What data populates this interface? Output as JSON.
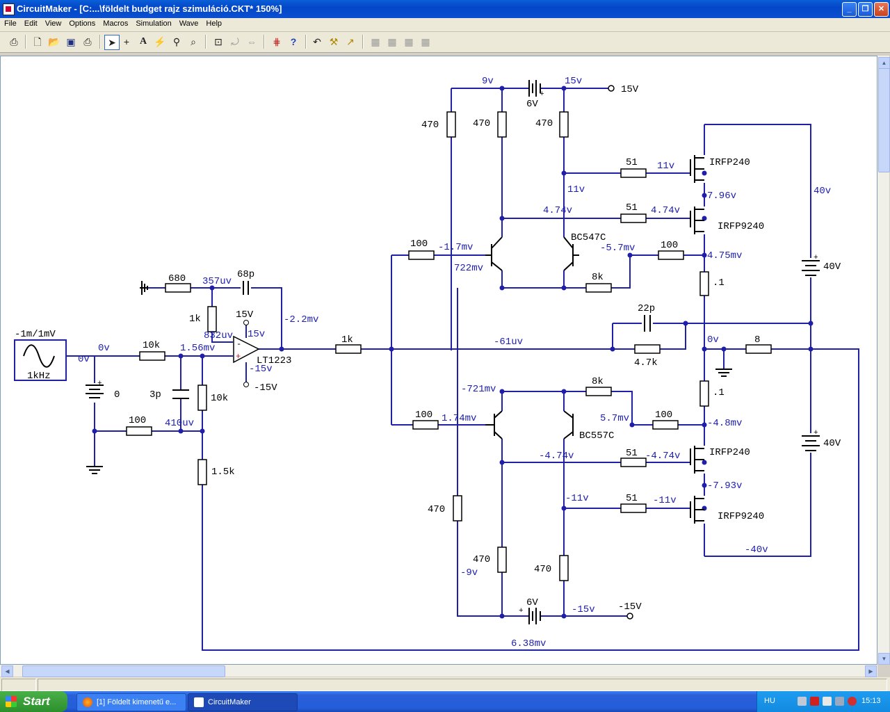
{
  "window": {
    "title": "CircuitMaker - [C:...\\földelt budget rajz szimuláció.CKT* 150%]",
    "minimize_icon": "minimize-icon",
    "maximize_icon": "restore-icon",
    "close_icon": "close-icon"
  },
  "menu": [
    "File",
    "Edit",
    "View",
    "Options",
    "Macros",
    "Simulation",
    "Wave",
    "Help"
  ],
  "toolbar": {
    "icons": [
      "print-setup-icon",
      "new-icon",
      "open-icon",
      "save-icon",
      "print-icon",
      "arrow-tool-icon",
      "wire-tool-icon",
      "text-tool-icon",
      "probe-tool-icon",
      "wand-tool-icon",
      "zoom-tool-icon",
      "zoom-fit-icon",
      "rotate-icon",
      "mirror-icon",
      "digital-sim-icon",
      "help-icon",
      "undo-icon",
      "tools-icon",
      "trace-icon",
      "align-icon-1",
      "align-icon-2",
      "align-icon-3",
      "align-icon-4"
    ]
  },
  "schematic": {
    "wire_color": "#1f1fa8",
    "voltage_color": "#2020b0",
    "component_labels": [
      {
        "id": "src-label",
        "text": "-1m/1mV"
      },
      {
        "id": "src-freq",
        "text": "1kHz"
      },
      {
        "id": "r-10k-in",
        "text": "10k"
      },
      {
        "id": "bat-0",
        "text": "0"
      },
      {
        "id": "c-3p",
        "text": "3p"
      },
      {
        "id": "r-100-fb",
        "text": "100"
      },
      {
        "id": "r-680",
        "text": "680"
      },
      {
        "id": "c-68p",
        "text": "68p"
      },
      {
        "id": "r-1k-v",
        "text": "1k"
      },
      {
        "id": "r-10k-v",
        "text": "10k"
      },
      {
        "id": "r-1k5",
        "text": "1.5k"
      },
      {
        "id": "opamp",
        "text": "LT1223"
      },
      {
        "id": "opamp-v15",
        "text": "15V"
      },
      {
        "id": "opamp-vm15",
        "text": "-15V"
      },
      {
        "id": "r-1k-out",
        "text": "1k"
      },
      {
        "id": "r-470-a",
        "text": "470"
      },
      {
        "id": "r-470-b",
        "text": "470"
      },
      {
        "id": "r-470-c",
        "text": "470"
      },
      {
        "id": "bat-6v-top",
        "text": "6V"
      },
      {
        "id": "term-15v",
        "text": "15V"
      },
      {
        "id": "r-51-a",
        "text": "51"
      },
      {
        "id": "r-51-b",
        "text": "51"
      },
      {
        "id": "q-irfp240-a",
        "text": "IRFP240"
      },
      {
        "id": "q-irfp9240-a",
        "text": "IRFP9240"
      },
      {
        "id": "q-bc547c",
        "text": "BC547C"
      },
      {
        "id": "r-100-a",
        "text": "100"
      },
      {
        "id": "r-100-b",
        "text": "100"
      },
      {
        "id": "r-8k-a",
        "text": "8k"
      },
      {
        "id": "r-01-a",
        "text": ".1"
      },
      {
        "id": "bat-40v-a",
        "text": "40V"
      },
      {
        "id": "c-22p",
        "text": "22p"
      },
      {
        "id": "r-4k7",
        "text": "4.7k"
      },
      {
        "id": "r-8-load",
        "text": "8"
      },
      {
        "id": "r-01-b",
        "text": ".1"
      },
      {
        "id": "bat-40v-b",
        "text": "40V"
      },
      {
        "id": "r-100-c",
        "text": "100"
      },
      {
        "id": "r-100-d",
        "text": "100"
      },
      {
        "id": "r-8k-b",
        "text": "8k"
      },
      {
        "id": "q-bc557c",
        "text": "BC557C"
      },
      {
        "id": "q-irfp240-b",
        "text": "IRFP240"
      },
      {
        "id": "q-irfp9240-b",
        "text": "IRFP9240"
      },
      {
        "id": "r-51-c",
        "text": "51"
      },
      {
        "id": "r-51-d",
        "text": "51"
      },
      {
        "id": "r-470-d",
        "text": "470"
      },
      {
        "id": "r-470-e",
        "text": "470"
      },
      {
        "id": "r-470-f",
        "text": "470"
      },
      {
        "id": "bat-6v-bot",
        "text": "6V"
      },
      {
        "id": "term-m15v",
        "text": "-15V"
      }
    ],
    "voltage_labels": [
      {
        "id": "v-0v-a",
        "text": "0v"
      },
      {
        "id": "v-0v-b",
        "text": "0v"
      },
      {
        "id": "v-1-56mv",
        "text": "1.56mv"
      },
      {
        "id": "v-357uv",
        "text": "357uv"
      },
      {
        "id": "v-332uv",
        "text": "832uv"
      },
      {
        "id": "v-15v-op",
        "text": "15v"
      },
      {
        "id": "v-m15v-op",
        "text": "-15v"
      },
      {
        "id": "v-m2-2mv",
        "text": "-2.2mv"
      },
      {
        "id": "v-410uv",
        "text": "410uv"
      },
      {
        "id": "v-9v",
        "text": "9v"
      },
      {
        "id": "v-15v-top",
        "text": "15v"
      },
      {
        "id": "v-11v-a",
        "text": "11v"
      },
      {
        "id": "v-11v-b",
        "text": "11v"
      },
      {
        "id": "v-7-96v",
        "text": "7.96v"
      },
      {
        "id": "v-40v",
        "text": "40v"
      },
      {
        "id": "v-4-74v-a",
        "text": "4.74v"
      },
      {
        "id": "v-4-74v-b",
        "text": "4.74v"
      },
      {
        "id": "v-m1-7mv",
        "text": "-1.7mv"
      },
      {
        "id": "v-722mv",
        "text": "722mv"
      },
      {
        "id": "v-m5-7mv",
        "text": "-5.7mv"
      },
      {
        "id": "v-4-75mv",
        "text": "4.75mv"
      },
      {
        "id": "v-m61uv",
        "text": "-61uv"
      },
      {
        "id": "v-0v-c",
        "text": "0v"
      },
      {
        "id": "v-m721mv",
        "text": "-721mv"
      },
      {
        "id": "v-1-74mv",
        "text": "1.74mv"
      },
      {
        "id": "v-5-7mv",
        "text": "5.7mv"
      },
      {
        "id": "v-m4-8mv",
        "text": "-4.8mv"
      },
      {
        "id": "v-m4-74v-a",
        "text": "-4.74v"
      },
      {
        "id": "v-m4-74v-b",
        "text": "-4.74v"
      },
      {
        "id": "v-m7-93v",
        "text": "-7.93v"
      },
      {
        "id": "v-m11v-a",
        "text": "-11v"
      },
      {
        "id": "v-m11v-b",
        "text": "-11v"
      },
      {
        "id": "v-m40v",
        "text": "-40v"
      },
      {
        "id": "v-m9v",
        "text": "-9v"
      },
      {
        "id": "v-m15v-bot",
        "text": "-15v"
      },
      {
        "id": "v-6-38mv",
        "text": "6.38mv"
      }
    ]
  },
  "taskbar": {
    "start_label": "Start",
    "tasks": [
      {
        "label": "[1] Földelt kimenetű e..."
      },
      {
        "label": "CircuitMaker"
      }
    ],
    "language": "HU",
    "clock": "15:13"
  }
}
